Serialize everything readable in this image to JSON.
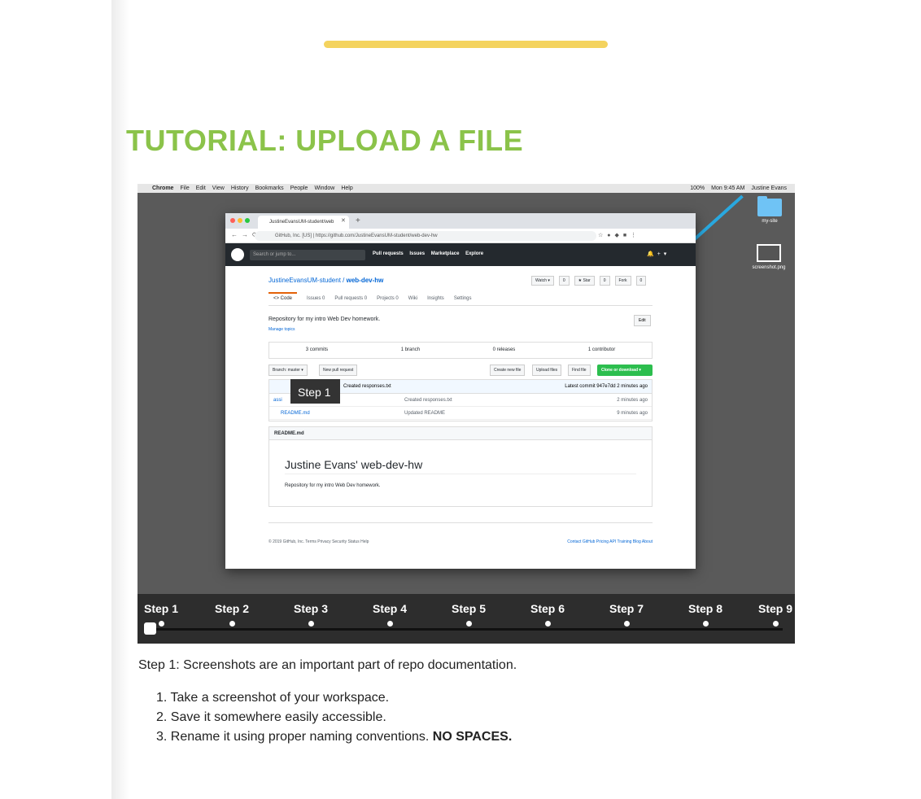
{
  "page": {
    "title": "TUTORIAL: UPLOAD A FILE"
  },
  "mac_menubar": {
    "items": [
      "Chrome",
      "File",
      "Edit",
      "View",
      "History",
      "Bookmarks",
      "People",
      "Window",
      "Help"
    ],
    "right_items": [
      "100%",
      "Mon 9:45 AM",
      "Justine Evans"
    ]
  },
  "desktop": {
    "folder_label": "my-site",
    "file_label": "screenshot.png"
  },
  "browser": {
    "tab_title": "JustineEvansUM-student/web",
    "url": "GitHub, Inc. [US]  |  https://github.com/JustineEvansUM-student/web-dev-hw"
  },
  "github": {
    "search_placeholder": "Search or jump to...",
    "nav": [
      "Pull requests",
      "Issues",
      "Marketplace",
      "Explore"
    ],
    "repo_owner": "JustineEvansUM-student",
    "repo_name": "web-dev-hw",
    "watch": "Watch ▾",
    "watch_count": "0",
    "star": "★ Star",
    "star_count": "0",
    "fork": "Fork",
    "fork_count": "0",
    "tabs": [
      "<> Code",
      "Issues 0",
      "Pull requests 0",
      "Projects 0",
      "Wiki",
      "Insights",
      "Settings"
    ],
    "description": "Repository for my intro Web Dev homework.",
    "manage_topics": "Manage topics",
    "edit": "Edit",
    "stats": [
      "3 commits",
      "1 branch",
      "0 releases",
      "1 contributor"
    ],
    "branch_button": "Branch: master ▾",
    "new_pr": "New pull request",
    "create_file": "Create new file",
    "upload_files": "Upload files",
    "find_file": "Find file",
    "clone": "Clone or download ▾",
    "commit_message": "Created responses.txt",
    "latest_commit": "Latest commit 947e7dd 2 minutes ago",
    "files": [
      {
        "name": "assi",
        "message": "Created responses.txt",
        "age": "2 minutes ago"
      },
      {
        "name": "README.md",
        "message": "Updated README",
        "age": "9 minutes ago"
      }
    ],
    "readme_header": "README.md",
    "readme_title": "Justine Evans' web-dev-hw",
    "readme_text": "Repository for my intro Web Dev homework.",
    "footer_left": "© 2019 GitHub, Inc.   Terms   Privacy   Security   Status   Help",
    "footer_right": "Contact GitHub   Pricing   API   Training   Blog   About"
  },
  "tooltip": "Step 1",
  "steps": [
    "Step 1",
    "Step 2",
    "Step 3",
    "Step 4",
    "Step 5",
    "Step 6",
    "Step 7",
    "Step 8",
    "Step 9"
  ],
  "caption": "Step 1: Screenshots are an important part of repo documentation.",
  "instructions": [
    "1. Take a screenshot of your workspace.",
    "2. Save it somewhere easily accessible.",
    "3. Rename it using proper naming conventions."
  ],
  "instruction_emphasis": "NO SPACES.",
  "colors": {
    "title_green": "#8bc34a",
    "accent_yellow": "#f4d35e",
    "arrow_blue": "#29a8df",
    "github_green": "#2cbe4e"
  }
}
